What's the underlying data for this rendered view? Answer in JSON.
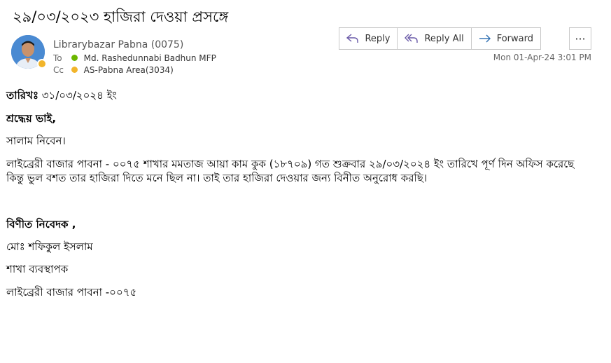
{
  "subject": "২৯/০৩/২০২৩ হাজিরা দেওয়া প্রসঙ্গে",
  "sender": {
    "name": "Librarybazar Pabna (0075)"
  },
  "recipients": {
    "to_label": "To",
    "to": "Md. Rashedunnabi Badhun MFP",
    "to_status_color": "#6bb700",
    "cc_label": "Cc",
    "cc": "AS-Pabna Area(3034)",
    "cc_status_color": "#f2b52b"
  },
  "actions": {
    "reply": "Reply",
    "reply_all": "Reply All",
    "forward": "Forward",
    "more": "···"
  },
  "date": "Mon 01-Apr-24 3:01 PM",
  "body": {
    "date_label": "তারিখঃ",
    "date_value": " ৩১/০৩/২০২৪ ইং",
    "greeting": "শ্রদ্ধেয় ভাই,",
    "salutation": "সালাম নিবেন।",
    "line1": "লাইব্রেরী বাজার পাবনা - ০০৭৫ শাখার মমতাজ  আয়া কাম কুক (১৮৭০৯)  গত শুক্রবার ২৯/০৩/২০২৪ ইং তারিখে পূর্ণ দিন অফিস করেছে",
    "line2": "কিন্তু ভুল বশত তার হাজিরা দিতে মনে ছিল না। তাই তার হাজিরা দেওয়ার জন্য বিনীত অনুরোধ করছি।",
    "closing": "বিণীত নিবেদক ,",
    "sig_name": "মোঃ শফিকুল  ইসলাম",
    "sig_title": "শাখা ব্যবস্থাপক",
    "sig_branch": "লাইব্রেরী বাজার পাবনা -০০৭৫"
  }
}
